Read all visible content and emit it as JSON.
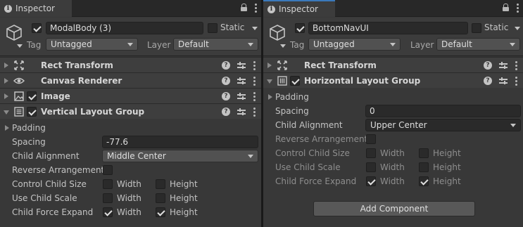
{
  "left": {
    "tab_title": "Inspector",
    "object_name": "ModalBody (3)",
    "static_label": "Static",
    "tag_label": "Tag",
    "tag_value": "Untagged",
    "layer_label": "Layer",
    "layer_value": "Default",
    "components": [
      {
        "title": "Rect Transform"
      },
      {
        "title": "Canvas Renderer"
      },
      {
        "title": "Image"
      },
      {
        "title": "Vertical Layout Group"
      }
    ],
    "props": {
      "padding": "Padding",
      "spacing_label": "Spacing",
      "spacing_value": "-77.6",
      "child_alignment_label": "Child Alignment",
      "child_alignment_value": "Middle Center",
      "reverse_label": "Reverse Arrangement",
      "control_label": "Control Child Size",
      "use_scale_label": "Use Child Scale",
      "force_expand_label": "Child Force Expand",
      "width": "Width",
      "height": "Height"
    }
  },
  "right": {
    "tab_title": "Inspector",
    "object_name": "BottomNavUI",
    "static_label": "Static",
    "tag_label": "Tag",
    "tag_value": "Untagged",
    "layer_label": "Layer",
    "layer_value": "Default",
    "components": [
      {
        "title": "Rect Transform"
      },
      {
        "title": "Horizontal Layout Group"
      }
    ],
    "props": {
      "padding": "Padding",
      "spacing_label": "Spacing",
      "spacing_value": "0",
      "child_alignment_label": "Child Alignment",
      "child_alignment_value": "Upper Center",
      "reverse_label": "Reverse Arrangement",
      "control_label": "Control Child Size",
      "use_scale_label": "Use Child Scale",
      "force_expand_label": "Child Force Expand",
      "width": "Width",
      "height": "Height"
    },
    "add_component": "Add Component"
  }
}
